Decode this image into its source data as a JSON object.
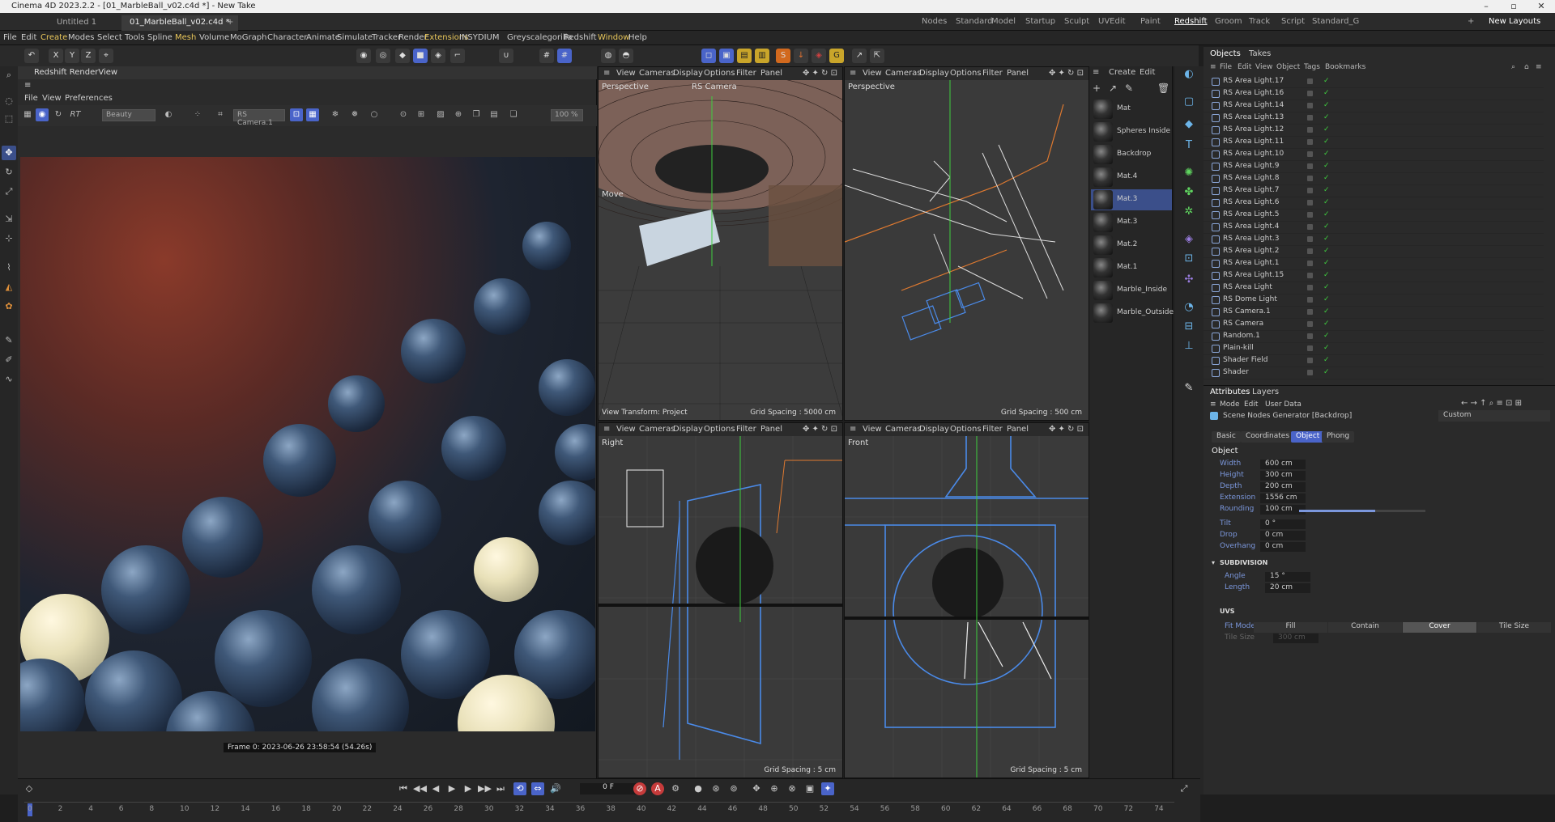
{
  "window": {
    "title": "Cinema 4D 2023.2.2 - [01_MarbleBall_v02.c4d *] - New Take"
  },
  "tabs": [
    "Untitled 1",
    "01_MarbleBall_v02.c4d *"
  ],
  "layouts": [
    "Nodes",
    "Standard",
    "Model",
    "Startup",
    "Sculpt",
    "UVEdit",
    "Paint",
    "Redshift",
    "Groom",
    "Track",
    "Script",
    "Standard_G"
  ],
  "active_layout": "Redshift",
  "new_layouts": "New Layouts",
  "menu": [
    "File",
    "Edit",
    "Create",
    "Modes",
    "Select",
    "Tools",
    "Spline",
    "Mesh",
    "Volume",
    "MoGraph",
    "Character",
    "Animate",
    "Simulate",
    "Tracker",
    "Render",
    "Extensions",
    "INSYDIUM",
    "Greyscalegorilla",
    "Redshift",
    "Window",
    "Help"
  ],
  "menu_highlight": [
    "Create",
    "Mesh",
    "Extensions",
    "Window"
  ],
  "renderview": {
    "title": "Redshift RenderView",
    "menu": [
      "File",
      "View",
      "Preferences"
    ],
    "aov": "Beauty",
    "camera": "RS Camera.1",
    "zoom": "100 %",
    "rt": "RT",
    "frame_info": "Frame 0: 2023-06-26 23:58:54 (54.26s)"
  },
  "viewports": [
    {
      "name": "Perspective",
      "camera": "RS Camera",
      "tool": "Move",
      "footer_left": "View Transform: Project",
      "grid": "Grid Spacing : 5000 cm"
    },
    {
      "name": "Perspective",
      "grid": "Grid Spacing : 500 cm"
    },
    {
      "name": "Right",
      "grid": "Grid Spacing : 5 cm"
    },
    {
      "name": "Front",
      "grid": "Grid Spacing : 5 cm"
    }
  ],
  "viewport_menu": [
    "View",
    "Cameras",
    "Display",
    "Options",
    "Filter",
    "Panel"
  ],
  "material_menu": [
    "Create",
    "Edit"
  ],
  "materials": [
    "Mat",
    "Spheres Inside",
    "Backdrop",
    "Mat.4",
    "Mat.3",
    "Mat.3",
    "Mat.2",
    "Mat.1",
    "Marble_Inside",
    "Marble_Outside"
  ],
  "selected_material": "Mat.3",
  "objects_panel": {
    "tabs": [
      "Objects",
      "Takes"
    ],
    "menu": [
      "File",
      "Edit",
      "View",
      "Object",
      "Tags",
      "Bookmarks"
    ],
    "items": [
      "RS Area Light.17",
      "RS Area Light.16",
      "RS Area Light.14",
      "RS Area Light.13",
      "RS Area Light.12",
      "RS Area Light.11",
      "RS Area Light.10",
      "RS Area Light.9",
      "RS Area Light.8",
      "RS Area Light.7",
      "RS Area Light.6",
      "RS Area Light.5",
      "RS Area Light.4",
      "RS Area Light.3",
      "RS Area Light.2",
      "RS Area Light.1",
      "RS Area Light.15",
      "RS Area Light",
      "RS Dome Light",
      "RS Camera.1",
      "RS Camera",
      "Random.1",
      "Plain-kill",
      "Shader Field",
      "Shader"
    ]
  },
  "attributes": {
    "tabs": [
      "Attributes",
      "Layers"
    ],
    "menu": [
      "Mode",
      "Edit",
      "User Data"
    ],
    "object_name": "Scene Nodes Generator [Backdrop]",
    "preset": "Custom",
    "buttons": [
      "Basic",
      "Coordinates",
      "Object",
      "Phong"
    ],
    "active_button": "Object",
    "section": "Object",
    "fields": [
      {
        "label": "Width",
        "value": "600 cm"
      },
      {
        "label": "Height",
        "value": "300 cm"
      },
      {
        "label": "Depth",
        "value": "200 cm"
      },
      {
        "label": "Extension",
        "value": "1556 cm"
      },
      {
        "label": "Rounding",
        "value": "100 cm"
      },
      {
        "label": "Tilt",
        "value": "0 °"
      },
      {
        "label": "Drop",
        "value": "0 cm"
      },
      {
        "label": "Overhang",
        "value": "0 cm"
      }
    ],
    "rounding_slider": 0.6,
    "subdivision": {
      "title": "SUBDIVISION",
      "fields": [
        {
          "label": "Angle",
          "value": "15 °"
        },
        {
          "label": "Length",
          "value": "20 cm"
        }
      ]
    },
    "uvs": {
      "title": "UVS",
      "fit_label": "Fit Mode",
      "fit_options": [
        "Fill",
        "Contain",
        "Cover",
        "Tile Size"
      ],
      "fit_active": "Cover",
      "tile_label": "Tile Size",
      "tile_value": "300 cm"
    }
  },
  "timeline": {
    "current_frame": "0 F",
    "ticks": [
      "0",
      "2",
      "4",
      "6",
      "8",
      "10",
      "12",
      "14",
      "16",
      "18",
      "20",
      "22",
      "24",
      "26",
      "28",
      "30",
      "32",
      "34",
      "36",
      "38",
      "40",
      "42",
      "44",
      "46",
      "48",
      "50",
      "52",
      "54",
      "56",
      "58",
      "60",
      "62",
      "64",
      "66",
      "68",
      "70",
      "72",
      "74"
    ]
  }
}
